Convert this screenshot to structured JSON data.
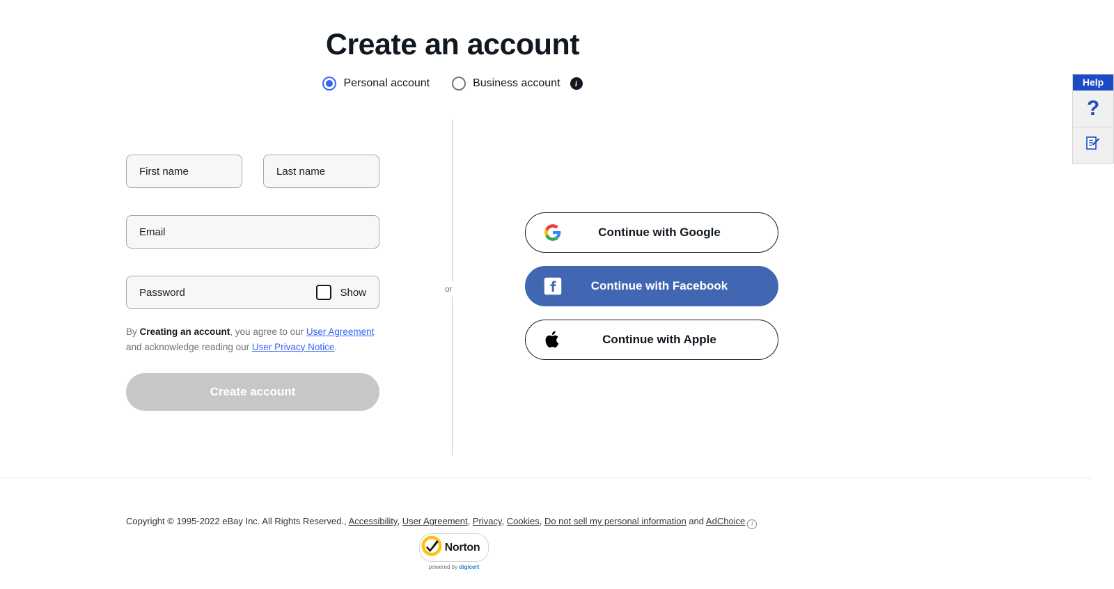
{
  "page": {
    "title": "Create an account"
  },
  "account_type": {
    "options": [
      {
        "label": "Personal account",
        "selected": true
      },
      {
        "label": "Business account",
        "selected": false
      }
    ],
    "info_icon": "info-icon",
    "info_glyph": "i"
  },
  "form": {
    "first_name": {
      "placeholder": "First name",
      "value": ""
    },
    "last_name": {
      "placeholder": "Last name",
      "value": ""
    },
    "email": {
      "placeholder": "Email",
      "value": ""
    },
    "password": {
      "placeholder": "Password",
      "value": ""
    },
    "show_password": {
      "label": "Show",
      "checked": false
    },
    "legal": {
      "prefix": "By ",
      "bold": "Creating an account",
      "mid1": ", you agree to our ",
      "link1": "User Agreement",
      "mid2": " and acknowledge reading our ",
      "link2": "User Privacy Notice",
      "suffix": "."
    },
    "submit": {
      "label": "Create account",
      "enabled": false
    }
  },
  "divider": {
    "label": "or"
  },
  "social": {
    "buttons": [
      {
        "label": "Continue with Google",
        "icon": "google-icon",
        "style": "outline"
      },
      {
        "label": "Continue with Facebook",
        "icon": "facebook-icon",
        "style": "facebook"
      },
      {
        "label": "Continue with Apple",
        "icon": "apple-icon",
        "style": "outline"
      }
    ]
  },
  "help_widget": {
    "header": "Help",
    "question_glyph": "?",
    "feedback_icon": "feedback-pencil-icon"
  },
  "footer": {
    "copyright": "Copyright © 1995-2022 eBay Inc. All Rights Reserved.",
    "links": [
      "Accessibility",
      "User Agreement",
      "Privacy",
      "Cookies",
      "Do not sell my personal information"
    ],
    "and": " and ",
    "adchoice": "AdChoice",
    "adchoice_glyph": "i",
    "separator": ", "
  },
  "norton": {
    "name": "Norton",
    "powered_prefix": "powered by ",
    "powered_brand": "digicert"
  },
  "colors": {
    "accent_blue": "#3665f3",
    "facebook_blue": "#4267b2",
    "help_blue": "#1d4bc4",
    "disabled_gray": "#c7c7c7",
    "field_bg": "#f7f7f7",
    "norton_yellow": "#ffc20e"
  }
}
